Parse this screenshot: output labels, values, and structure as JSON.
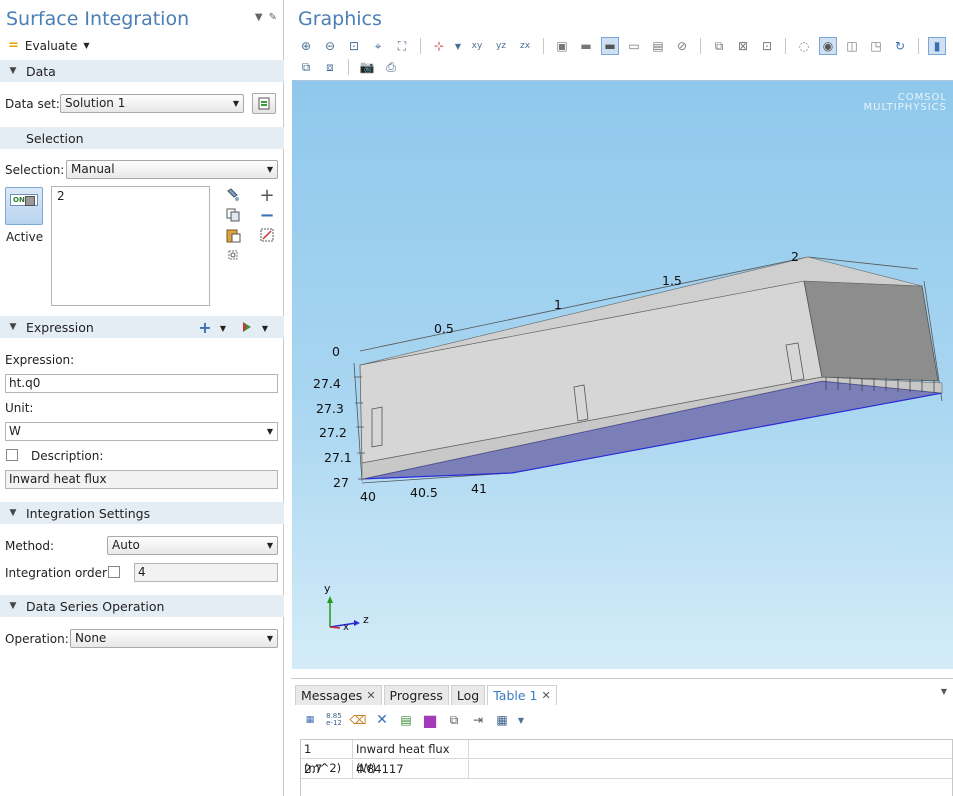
{
  "left_panel": {
    "title": "Surface Integration",
    "evaluate_label": "Evaluate",
    "sections": {
      "data": "Data",
      "selection": "Selection",
      "expression": "Expression",
      "integration_settings": "Integration Settings",
      "data_series_operation": "Data Series Operation"
    },
    "data_set_label": "Data set:",
    "data_set_value": "Solution 1",
    "selection_label": "Selection:",
    "selection_value": "Manual",
    "selection_items": "2",
    "active_label": "Active",
    "active_toggle_text": "ON",
    "expression_label": "Expression:",
    "expression_value": "ht.q0",
    "unit_label": "Unit:",
    "unit_value": "W",
    "description_label": "Description:",
    "description_value": "Inward heat flux",
    "method_label": "Method:",
    "method_value": "Auto",
    "integration_order_label": "Integration order:",
    "integration_order_value": "4",
    "operation_label": "Operation:",
    "operation_value": "None"
  },
  "graphics": {
    "title": "Graphics",
    "logo_line1": "COMSOL",
    "logo_line2": "MULTIPHYSICS",
    "top_ticks": [
      "0",
      "0.5",
      "1",
      "1.5",
      "2"
    ],
    "left_ticks": [
      "27.4",
      "27.3",
      "27.2",
      "27.1",
      "27"
    ],
    "bottom_ticks": [
      "40",
      "40.5",
      "41"
    ],
    "triad": {
      "y": "y",
      "x": "x",
      "z": "z"
    }
  },
  "bottom_panel": {
    "tabs": [
      {
        "label": "Messages",
        "closable": true
      },
      {
        "label": "Progress",
        "closable": false
      },
      {
        "label": "Log",
        "closable": false
      },
      {
        "label": "Table 1",
        "closable": true,
        "active": true
      }
    ],
    "table": {
      "headers": [
        "1 (m^2)",
        "Inward heat flux (W)"
      ],
      "rows": [
        [
          "2.7",
          "4.84117"
        ]
      ]
    }
  }
}
